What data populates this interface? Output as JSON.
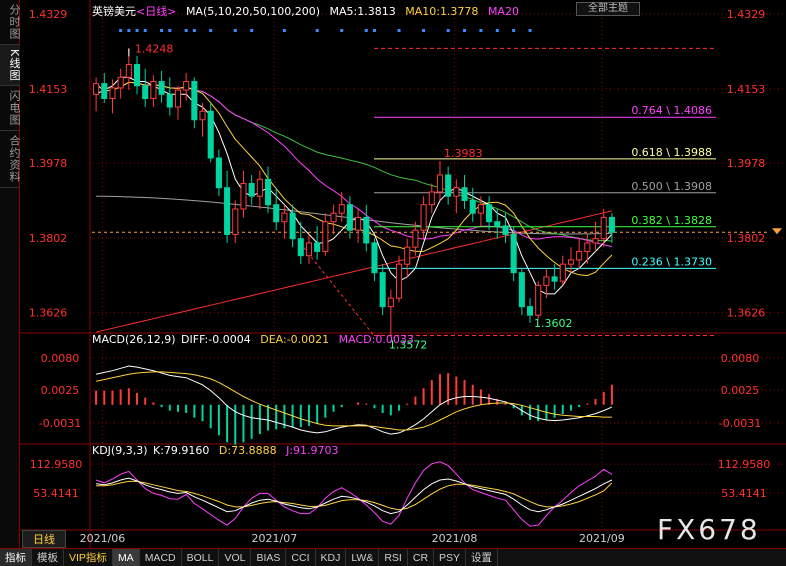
{
  "left_tabs": [
    {
      "label": "分时图",
      "active": false
    },
    {
      "label": "K线图",
      "active": true
    },
    {
      "label": "闪电图",
      "active": false
    },
    {
      "label": "合约资料",
      "active": false
    }
  ],
  "legend_main": {
    "symbol": "英镑美元",
    "period": "<日线>",
    "ma_params": "MA(5,10,20,50,100,200)",
    "ma5": "MA5:1.3813",
    "ma10": "MA10:1.3778",
    "ma20": "MA20"
  },
  "theme_button": "全部主题",
  "legend_macd": {
    "params": "MACD(26,12,9)",
    "diff": "DIFF:-0.0004",
    "dea": "DEA:-0.0021",
    "macd": "MACD:0.0033"
  },
  "legend_kdj": {
    "params": "KDJ(9,3,3)",
    "k": "K:79.9160",
    "d": "D:73.8888",
    "j": "J:91.9703"
  },
  "period_button": "日线",
  "bottom_bar": [
    "指标",
    "模板",
    "VIP指标",
    "MA",
    "MACD",
    "BOLL",
    "VOL",
    "BIAS",
    "CCI",
    "KDJ",
    "LW&",
    "RSI",
    "CR",
    "PSY",
    "设置"
  ],
  "watermark": "FX678",
  "colors": {
    "up": "#ff3c3c",
    "down": "#00d4a0",
    "ma5": "#ffffff",
    "ma10": "#ffd23c",
    "ma20": "#ff40ff",
    "ma50": "#40c040",
    "ma100": "#a0a0a0",
    "ma200": "#ff3030",
    "grid": "#8a0000"
  },
  "chart_data": [
    {
      "type": "candlestick",
      "title": "英镑美元 <日线>",
      "x_tick_labels": [
        "2021/06",
        "2021/07",
        "2021/08",
        "2021/09"
      ],
      "y_tick_labels": [
        "1.4329",
        "1.4153",
        "1.3978",
        "1.3802",
        "1.3626"
      ],
      "ylim": [
        1.3585,
        1.4329
      ],
      "annotations": {
        "high": "1.4248",
        "low": "1.3572",
        "swing_high": "1.3983",
        "swing_low": "1.3602"
      },
      "fibonacci_levels": [
        {
          "label": "0.764 \\ 1.4086",
          "value": 1.4086
        },
        {
          "label": "0.618 \\ 1.3988",
          "value": 1.3988
        },
        {
          "label": "0.500 \\ 1.3908",
          "value": 1.3908
        },
        {
          "label": "0.382 \\ 1.3828",
          "value": 1.3828
        },
        {
          "label": "0.236 \\ 1.3730",
          "value": 1.373
        }
      ],
      "ohlc": [
        [
          1.414,
          1.418,
          1.41,
          1.4165
        ],
        [
          1.4165,
          1.419,
          1.412,
          1.413
        ],
        [
          1.413,
          1.4175,
          1.4095,
          1.4155
        ],
        [
          1.4155,
          1.42,
          1.413,
          1.418
        ],
        [
          1.418,
          1.4248,
          1.415,
          1.421
        ],
        [
          1.421,
          1.423,
          1.414,
          1.416
        ],
        [
          1.416,
          1.42,
          1.411,
          1.413
        ],
        [
          1.413,
          1.4185,
          1.411,
          1.417
        ],
        [
          1.417,
          1.4195,
          1.412,
          1.414
        ],
        [
          1.414,
          1.418,
          1.409,
          1.411
        ],
        [
          1.411,
          1.416,
          1.408,
          1.415
        ],
        [
          1.415,
          1.419,
          1.4125,
          1.417
        ],
        [
          1.417,
          1.418,
          1.406,
          1.408
        ],
        [
          1.408,
          1.412,
          1.404,
          1.41
        ],
        [
          1.41,
          1.412,
          1.398,
          1.399
        ],
        [
          1.399,
          1.401,
          1.39,
          1.392
        ],
        [
          1.392,
          1.396,
          1.379,
          1.381
        ],
        [
          1.381,
          1.389,
          1.379,
          1.387
        ],
        [
          1.387,
          1.396,
          1.385,
          1.393
        ],
        [
          1.393,
          1.395,
          1.388,
          1.39
        ],
        [
          1.39,
          1.396,
          1.387,
          1.394
        ],
        [
          1.394,
          1.397,
          1.386,
          1.388
        ],
        [
          1.388,
          1.392,
          1.382,
          1.384
        ],
        [
          1.384,
          1.388,
          1.38,
          1.386
        ],
        [
          1.386,
          1.388,
          1.378,
          1.38
        ],
        [
          1.38,
          1.384,
          1.374,
          1.376
        ],
        [
          1.376,
          1.381,
          1.374,
          1.379
        ],
        [
          1.379,
          1.383,
          1.375,
          1.377
        ],
        [
          1.377,
          1.386,
          1.376,
          1.384
        ],
        [
          1.384,
          1.388,
          1.381,
          1.386
        ],
        [
          1.386,
          1.391,
          1.384,
          1.388
        ],
        [
          1.388,
          1.39,
          1.38,
          1.382
        ],
        [
          1.382,
          1.387,
          1.379,
          1.385
        ],
        [
          1.385,
          1.388,
          1.377,
          1.379
        ],
        [
          1.379,
          1.38,
          1.37,
          1.372
        ],
        [
          1.372,
          1.374,
          1.362,
          1.364
        ],
        [
          1.364,
          1.368,
          1.3572,
          1.366
        ],
        [
          1.366,
          1.376,
          1.365,
          1.374
        ],
        [
          1.374,
          1.38,
          1.371,
          1.378
        ],
        [
          1.378,
          1.384,
          1.376,
          1.382
        ],
        [
          1.382,
          1.39,
          1.38,
          1.388
        ],
        [
          1.388,
          1.393,
          1.386,
          1.391
        ],
        [
          1.391,
          1.3983,
          1.389,
          1.395
        ],
        [
          1.395,
          1.397,
          1.388,
          1.39
        ],
        [
          1.39,
          1.394,
          1.386,
          1.392
        ],
        [
          1.392,
          1.395,
          1.387,
          1.389
        ],
        [
          1.389,
          1.392,
          1.384,
          1.386
        ],
        [
          1.386,
          1.39,
          1.383,
          1.388
        ],
        [
          1.388,
          1.39,
          1.382,
          1.384
        ],
        [
          1.384,
          1.387,
          1.38,
          1.383
        ],
        [
          1.383,
          1.386,
          1.379,
          1.381
        ],
        [
          1.381,
          1.383,
          1.37,
          1.372
        ],
        [
          1.372,
          1.373,
          1.362,
          1.364
        ],
        [
          1.364,
          1.366,
          1.3602,
          1.362
        ],
        [
          1.362,
          1.37,
          1.361,
          1.369
        ],
        [
          1.369,
          1.373,
          1.366,
          1.371
        ],
        [
          1.371,
          1.374,
          1.368,
          1.37
        ],
        [
          1.37,
          1.376,
          1.369,
          1.374
        ],
        [
          1.374,
          1.378,
          1.372,
          1.375
        ],
        [
          1.375,
          1.38,
          1.373,
          1.377
        ],
        [
          1.377,
          1.381,
          1.374,
          1.379
        ],
        [
          1.379,
          1.384,
          1.377,
          1.38
        ],
        [
          1.38,
          1.387,
          1.378,
          1.385
        ],
        [
          1.385,
          1.386,
          1.379,
          1.3815
        ]
      ],
      "moving_averages": {
        "MA5": [
          1.414,
          1.415,
          1.416,
          1.418,
          1.418,
          1.417,
          1.417,
          1.416,
          1.415,
          1.414,
          1.414,
          1.414,
          1.412,
          1.411,
          1.409,
          1.405,
          1.4,
          1.394,
          1.391,
          1.39,
          1.391,
          1.392,
          1.39,
          1.388,
          1.386,
          1.383,
          1.381,
          1.379,
          1.379,
          1.38,
          1.382,
          1.384,
          1.385,
          1.384,
          1.381,
          1.376,
          1.372,
          1.37,
          1.371,
          1.373,
          1.379,
          1.385,
          1.389,
          1.391,
          1.392,
          1.391,
          1.39,
          1.389,
          1.388,
          1.386,
          1.385,
          1.381,
          1.376,
          1.372,
          1.368,
          1.367,
          1.367,
          1.369,
          1.372,
          1.373,
          1.375,
          1.377,
          1.379,
          1.381
        ]
      },
      "macd_panel": {
        "y_tick_labels": [
          "0.0080",
          "0.0025",
          "-0.0031"
        ],
        "ylim": [
          -0.006,
          0.01
        ],
        "DIFF": [
          0.0052,
          0.0055,
          0.0058,
          0.0062,
          0.0066,
          0.0064,
          0.0061,
          0.0058,
          0.0054,
          0.005,
          0.0048,
          0.0046,
          0.004,
          0.0034,
          0.0024,
          0.0012,
          -0.0002,
          -0.0012,
          -0.0018,
          -0.0022,
          -0.0024,
          -0.0026,
          -0.003,
          -0.0034,
          -0.0038,
          -0.0043,
          -0.0046,
          -0.0048,
          -0.0046,
          -0.0042,
          -0.0038,
          -0.0036,
          -0.0034,
          -0.0035,
          -0.004,
          -0.0046,
          -0.005,
          -0.0048,
          -0.0042,
          -0.0034,
          -0.0024,
          -0.0012,
          0.0,
          0.0008,
          0.0012,
          0.0014,
          0.0014,
          0.0013,
          0.0011,
          0.0008,
          0.0005,
          -0.0001,
          -0.001,
          -0.0018,
          -0.0023,
          -0.0026,
          -0.0027,
          -0.0026,
          -0.0024,
          -0.0022,
          -0.0019,
          -0.0015,
          -0.001,
          -0.0004
        ],
        "DEA": [
          0.004,
          0.0043,
          0.0046,
          0.0049,
          0.0052,
          0.0054,
          0.0055,
          0.0056,
          0.0056,
          0.0055,
          0.0054,
          0.0053,
          0.0051,
          0.0048,
          0.0044,
          0.0038,
          0.003,
          0.0022,
          0.0014,
          0.0007,
          0.0001,
          -0.0004,
          -0.0009,
          -0.0014,
          -0.0019,
          -0.0024,
          -0.0028,
          -0.0032,
          -0.0035,
          -0.0036,
          -0.0036,
          -0.0036,
          -0.0036,
          -0.0036,
          -0.0037,
          -0.0039,
          -0.0041,
          -0.0043,
          -0.0043,
          -0.0041,
          -0.0038,
          -0.0033,
          -0.0026,
          -0.0019,
          -0.0012,
          -0.0007,
          -0.0003,
          0.0,
          0.0002,
          0.0003,
          0.0003,
          0.0002,
          -0.0001,
          -0.0005,
          -0.0009,
          -0.0013,
          -0.0016,
          -0.0018,
          -0.0019,
          -0.002,
          -0.002,
          -0.002,
          -0.0021,
          -0.0021
        ]
      },
      "kdj_panel": {
        "y_tick_labels": [
          "112.9580",
          "53.4141"
        ],
        "ylim": [
          -20,
          130
        ],
        "K": [
          72,
          70,
          74,
          80,
          84,
          78,
          70,
          64,
          60,
          55,
          52,
          54,
          45,
          38,
          30,
          22,
          14,
          16,
          24,
          32,
          38,
          40,
          36,
          30,
          26,
          22,
          20,
          24,
          32,
          40,
          46,
          44,
          40,
          34,
          26,
          16,
          10,
          14,
          28,
          44,
          60,
          72,
          80,
          82,
          78,
          72,
          66,
          62,
          58,
          54,
          50,
          40,
          28,
          18,
          14,
          18,
          24,
          30,
          38,
          46,
          54,
          62,
          72,
          79.916
        ],
        "D": [
          68,
          68,
          70,
          74,
          77,
          77,
          74,
          70,
          66,
          62,
          58,
          56,
          52,
          47,
          41,
          35,
          28,
          24,
          24,
          27,
          31,
          34,
          35,
          33,
          31,
          28,
          25,
          25,
          27,
          32,
          37,
          39,
          39,
          37,
          33,
          27,
          21,
          18,
          21,
          29,
          40,
          51,
          61,
          68,
          71,
          71,
          69,
          66,
          63,
          60,
          56,
          51,
          43,
          35,
          28,
          24,
          24,
          26,
          30,
          35,
          42,
          49,
          57,
          73.8888
        ],
        "J": [
          80,
          74,
          82,
          92,
          98,
          80,
          62,
          52,
          48,
          41,
          40,
          50,
          31,
          20,
          8,
          -4,
          -14,
          0,
          24,
          42,
          52,
          52,
          38,
          24,
          16,
          10,
          10,
          22,
          42,
          56,
          64,
          54,
          42,
          28,
          12,
          -6,
          -12,
          6,
          42,
          74,
          100,
          114,
          118,
          110,
          92,
          74,
          60,
          54,
          48,
          42,
          38,
          18,
          -2,
          -16,
          -14,
          6,
          24,
          38,
          54,
          68,
          78,
          88,
          102,
          91.9703
        ]
      }
    }
  ]
}
